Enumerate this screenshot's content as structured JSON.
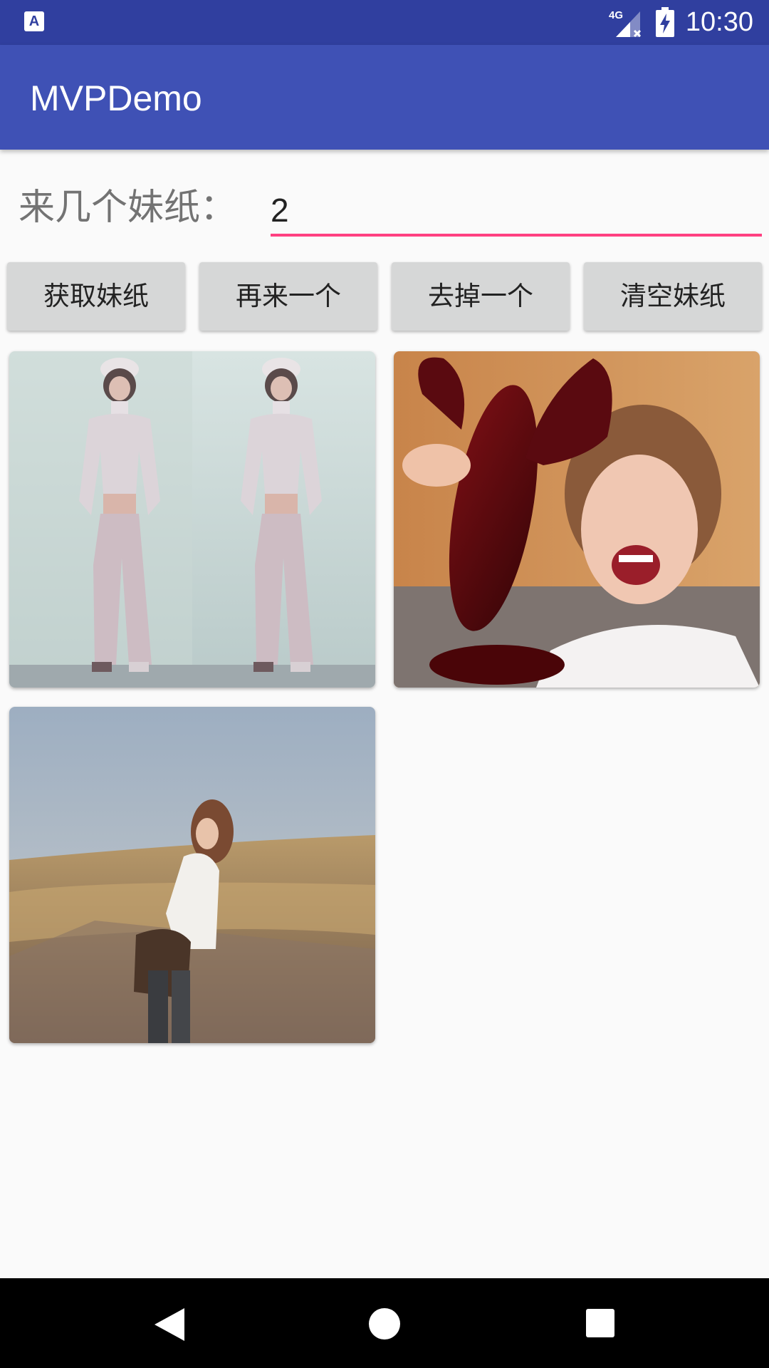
{
  "status_bar": {
    "time": "10:30",
    "network": "4G",
    "left_icon": "A",
    "icons": [
      "app-notification-icon",
      "signal-icon",
      "battery-charging-icon"
    ]
  },
  "app_bar": {
    "title": "MVPDemo"
  },
  "count": {
    "label": "来几个妹纸：",
    "value": "2"
  },
  "buttons": [
    {
      "label": "获取妹纸"
    },
    {
      "label": "再来一个"
    },
    {
      "label": "去掉一个"
    },
    {
      "label": "清空妹纸"
    }
  ],
  "gallery": {
    "items": [
      {
        "description": "photo-woman-white-outfit-mirror"
      },
      {
        "description": "photo-woman-holding-lobster-toy"
      },
      {
        "description": "photo-woman-in-field"
      }
    ]
  },
  "nav_bar": {
    "icons": [
      "back-icon",
      "home-icon",
      "recents-icon"
    ]
  },
  "colors": {
    "status_bar": "#303F9F",
    "app_bar": "#3F51B5",
    "accent": "#FF4081",
    "button": "#D6D7D7"
  }
}
